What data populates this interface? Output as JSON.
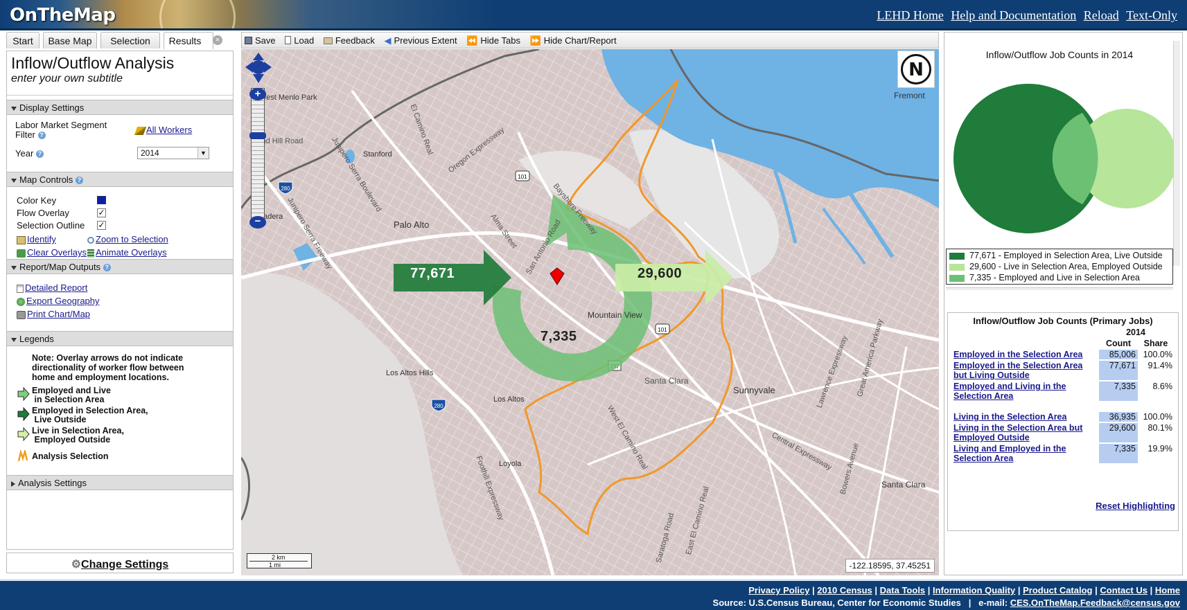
{
  "header": {
    "title": "OnTheMap",
    "links": [
      "LEHD Home",
      "Help and Documentation",
      "Reload",
      "Text-Only"
    ]
  },
  "tabs": [
    "Start",
    "Base Map",
    "Selection",
    "Results"
  ],
  "analysis": {
    "title": "Inflow/Outflow Analysis",
    "subtitle": "enter your own subtitle"
  },
  "display_settings": {
    "header": "Display Settings",
    "segment_label": "Labor Market Segment Filter",
    "segment_value": "All Workers",
    "year_label": "Year",
    "year_value": "2014"
  },
  "map_controls": {
    "header": "Map Controls",
    "color_key": "Color Key",
    "flow_overlay": "Flow Overlay",
    "selection_outline": "Selection Outline",
    "identify": "Identify",
    "zoom": "Zoom to Selection",
    "clear": "Clear Overlays",
    "animate": "Animate Overlays",
    "check": "✓",
    "color_key_color": "#0c1faa"
  },
  "outputs": {
    "header": "Report/Map Outputs",
    "detailed": "Detailed Report",
    "export": "Export Geography",
    "print": "Print Chart/Map"
  },
  "legends": {
    "header": "Legends",
    "note": "Note: Overlay arrows do not indicate directionality of worker flow between home and employment locations.",
    "items": [
      "Employed and Live",
      "in Selection Area",
      "Employed in Selection Area,",
      "Live Outside",
      "Live in Selection Area,",
      "Employed Outside"
    ],
    "analysis_selection": "Analysis Selection"
  },
  "analysis_settings": "Analysis Settings",
  "change_settings": "Change Settings",
  "toolbar": [
    "Save",
    "Load",
    "Feedback",
    "Previous Extent",
    "Hide Tabs",
    "Hide Chart/Report"
  ],
  "map": {
    "flow_in": "77,671",
    "flow_out": "29,600",
    "flow_both": "7,335",
    "coordinates": "-122.18595, 37.45251",
    "scale_km": "2 km",
    "scale_mi": "1 mi",
    "compass": "N",
    "labels": [
      "West Menlo Park",
      "Stanford",
      "Palo Alto",
      "Mountain View",
      "Los Altos Hills",
      "Los Altos",
      "Santa Clara",
      "Sunnyvale",
      "Loyola",
      "Fremont",
      "Ladera",
      "Santa Clara"
    ],
    "roads": [
      "Junipero Serra Boulevard",
      "El Camino Real",
      "Oregon Expressway",
      "Alma Street",
      "San Antonio Road",
      "Bayshore Freeway",
      "Junipero Serra Freeway",
      "West El Camino Real",
      "Central Expressway",
      "Lawrence Expressway",
      "Foothill Expressway",
      "Bowers Avenue",
      "Great America Parkway",
      "East El Camino Real",
      "Saratoga Road",
      "Sand Hill Road"
    ],
    "shields": [
      "101",
      "280",
      "280",
      "237",
      "101"
    ]
  },
  "chart": {
    "title": "Inflow/Outflow Job Counts in 2014",
    "legend": [
      {
        "label": "77,671 - Employed in Selection Area, Live Outside",
        "color": "#1f7c3a"
      },
      {
        "label": "29,600 - Live in Selection Area, Employed Outside",
        "color": "#b7e59a"
      },
      {
        "label": "7,335 - Employed and Live in Selection Area",
        "color": "#6cc074"
      }
    ]
  },
  "table": {
    "title": "Inflow/Outflow Job Counts (Primary Jobs)",
    "year": "2014",
    "col_count": "Count",
    "col_share": "Share",
    "rows": [
      {
        "label": "Employed in the Selection Area",
        "count": "85,006",
        "share": "100.0%"
      },
      {
        "label": "Employed in the Selection Area but Living Outside",
        "count": "77,671",
        "share": "91.4%"
      },
      {
        "label": "Employed and Living in the Selection Area",
        "count": "7,335",
        "share": "8.6%"
      },
      {
        "label": "Living in the Selection Area",
        "count": "36,935",
        "share": "100.0%"
      },
      {
        "label": "Living in the Selection Area but Employed Outside",
        "count": "29,600",
        "share": "80.1%"
      },
      {
        "label": "Living and Employed in the Selection Area",
        "count": "7,335",
        "share": "19.9%"
      }
    ],
    "reset": "Reset Highlighting"
  },
  "footer": {
    "links": [
      "Privacy Policy",
      "2010 Census",
      "Data Tools",
      "Information Quality",
      "Product Catalog",
      "Contact Us",
      "Home"
    ],
    "source": "Source: U.S.Census Bureau, Center for Economic Studies",
    "email_label": "e-mail:",
    "email": "CES.OnTheMap.Feedback@census.gov"
  }
}
